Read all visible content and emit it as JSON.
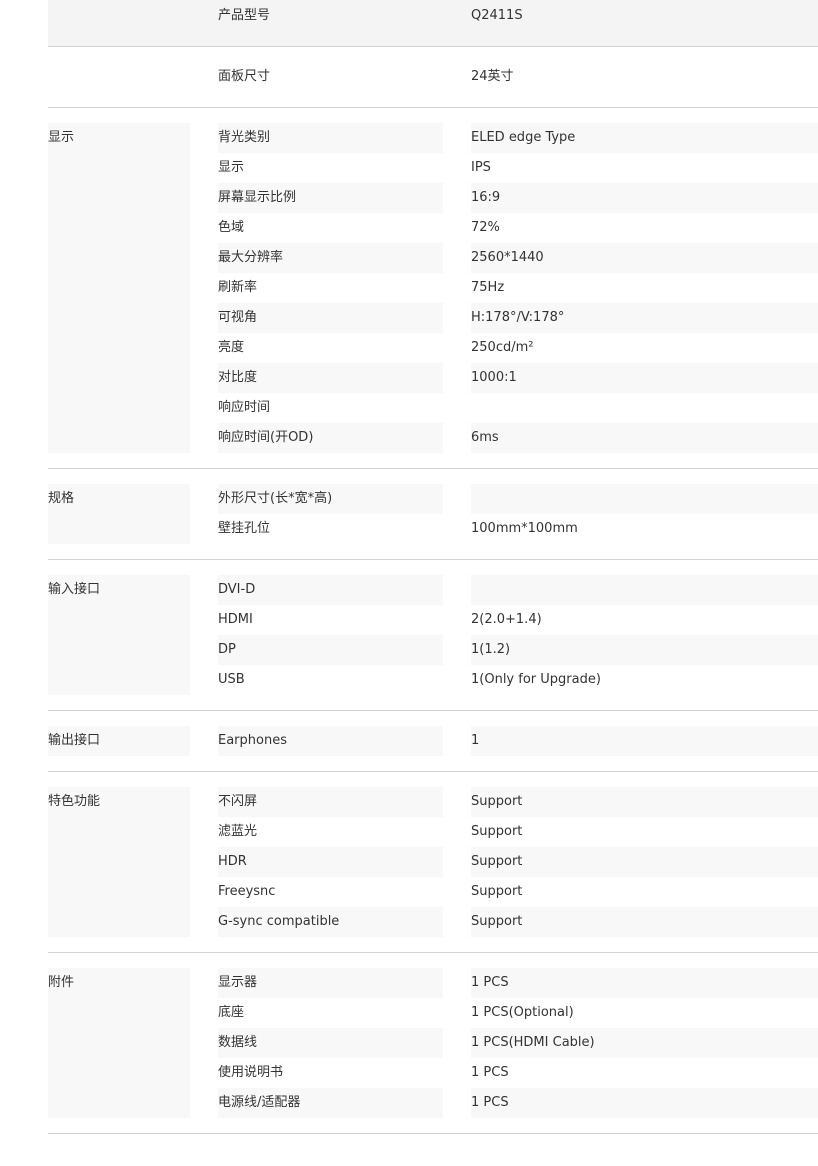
{
  "groups": [
    {
      "label": "",
      "rows": [
        {
          "name": "产品型号",
          "value": "Q2411S"
        }
      ]
    },
    {
      "label": "",
      "rows": [
        {
          "name": "面板尺寸",
          "value": "24英寸"
        }
      ]
    },
    {
      "label": "显示",
      "rows": [
        {
          "name": "背光类别",
          "value": "ELED edge Type"
        },
        {
          "name": "显示",
          "value": "IPS"
        },
        {
          "name": "屏幕显示比例",
          "value": "16:9"
        },
        {
          "name": "色域",
          "value": "72%"
        },
        {
          "name": "最大分辨率",
          "value": "2560*1440"
        },
        {
          "name": "刷新率",
          "value": "75Hz"
        },
        {
          "name": "可视角",
          "value": "H:178°/V:178°"
        },
        {
          "name": "亮度",
          "value": "250cd/m²"
        },
        {
          "name": "对比度",
          "value": "1000:1"
        },
        {
          "name": "响应时间",
          "value": ""
        },
        {
          "name": "响应时间(开OD)",
          "value": "6ms"
        }
      ]
    },
    {
      "label": "规格",
      "rows": [
        {
          "name": "外形尺寸(长*宽*高)",
          "value": ""
        },
        {
          "name": "壁挂孔位",
          "value": "100mm*100mm"
        }
      ]
    },
    {
      "label": "输入接口",
      "rows": [
        {
          "name": "DVI-D",
          "value": ""
        },
        {
          "name": "HDMI",
          "value": "2(2.0+1.4)"
        },
        {
          "name": "DP",
          "value": "1(1.2)"
        },
        {
          "name": "USB",
          "value": "1(Only for Upgrade)"
        }
      ]
    },
    {
      "label": "输出接口",
      "rows": [
        {
          "name": "Earphones",
          "value": "1"
        }
      ]
    },
    {
      "label": "特色功能",
      "rows": [
        {
          "name": "不闪屏",
          "value": "Support"
        },
        {
          "name": "滤蓝光",
          "value": "Support"
        },
        {
          "name": "HDR",
          "value": "Support"
        },
        {
          "name": "Freeysnc",
          "value": "Support"
        },
        {
          "name": "G-sync compatible",
          "value": "Support"
        }
      ]
    },
    {
      "label": "附件",
      "rows": [
        {
          "name": "显示器",
          "value": "1 PCS"
        },
        {
          "name": "底座",
          "value": "1 PCS(Optional)"
        },
        {
          "name": "数据线",
          "value": "1 PCS(HDMI Cable)"
        },
        {
          "name": "使用说明书",
          "value": "1 PCS"
        },
        {
          "name": "电源线/适配器",
          "value": "1 PCS"
        }
      ]
    }
  ]
}
